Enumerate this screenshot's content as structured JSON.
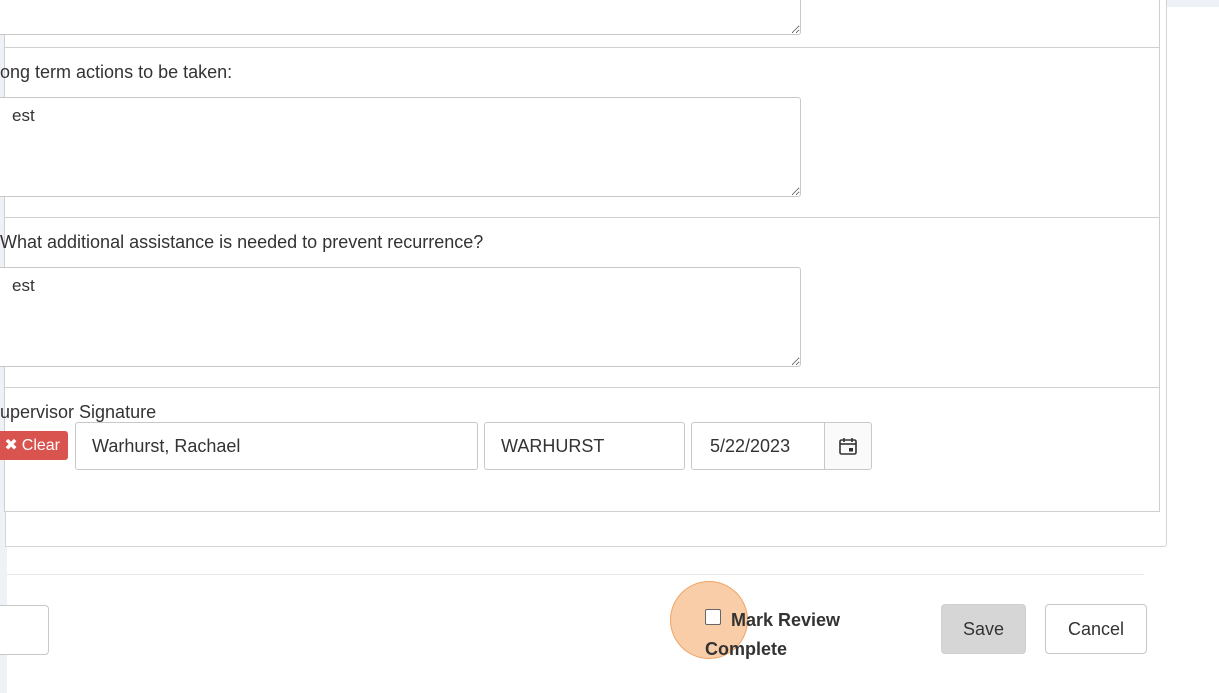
{
  "sections": {
    "top_textarea": {
      "value": ""
    },
    "long_term": {
      "label": "ong term actions to be taken:",
      "value": "est"
    },
    "additional": {
      "label": "What additional assistance is needed to prevent recurrence?",
      "value": "est"
    },
    "signature": {
      "label": "upervisor Signature",
      "clear_label": "Clear",
      "name_value": "Warhurst, Rachael",
      "username_value": "WARHURST",
      "date_value": "5/22/2023"
    }
  },
  "footer": {
    "checkbox_label": "Mark Review Complete",
    "checkbox_checked": false,
    "save_label": "Save",
    "cancel_label": "Cancel"
  },
  "colors": {
    "clear_button": "#d9534f",
    "highlight": "#f4a460",
    "save_button": "#d6d6d6"
  },
  "icons": {
    "clear": "close-icon",
    "date": "calendar-icon",
    "resize": "resize-handle-icon"
  }
}
